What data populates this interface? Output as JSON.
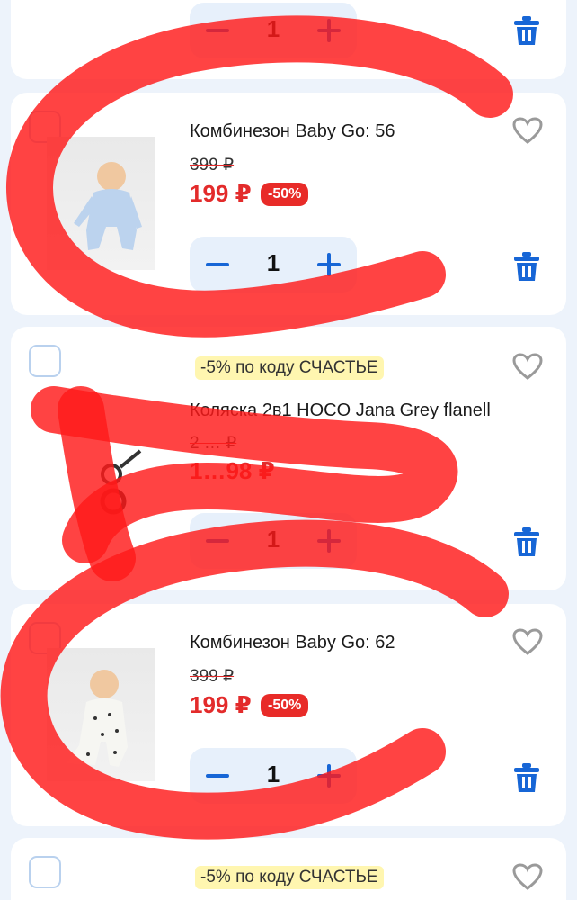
{
  "cart": {
    "items": [
      {
        "quantity": "1"
      },
      {
        "title": "Комбинезон Baby Go: 56",
        "old_price": "399 ₽",
        "price": "199 ₽",
        "discount": "-50%",
        "quantity": "1"
      },
      {
        "promo": "-5% по коду СЧАСТЬЕ",
        "title": "Коляска 2в1 HOCO Jana Grey flanell",
        "old_price": "2 … ₽",
        "price": "1…98 ₽",
        "quantity": "1"
      },
      {
        "title": "Комбинезон Baby Go: 62",
        "old_price": "399 ₽",
        "price": "199 ₽",
        "discount": "-50%",
        "quantity": "1"
      },
      {
        "promo": "-5% по коду СЧАСТЬЕ"
      }
    ]
  },
  "icons": {
    "remove": "trash-icon",
    "favorite": "heart-icon",
    "decrease": "minus-icon",
    "increase": "plus-icon"
  },
  "colors": {
    "accent": "#1766d6",
    "sale": "#e32b2b",
    "promo_bg": "#fff6b0",
    "scribble": "#ff1a1a"
  }
}
